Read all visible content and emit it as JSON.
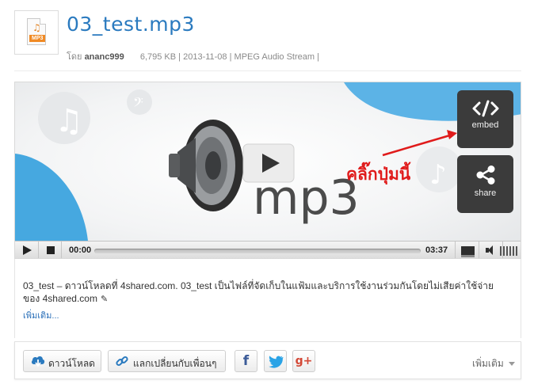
{
  "file": {
    "icon_tag": "MP3",
    "title": "03_test.mp3",
    "meta": {
      "by_label": "โดย",
      "owner": "ananc999",
      "size": "6,795 KB",
      "date": "2013-11-08",
      "type": "MPEG Audio Stream"
    }
  },
  "player": {
    "art_text": "mp3",
    "embed_label": "embed",
    "share_label": "share",
    "annotation": "คลิ๊กปุ่มนี้",
    "current_time": "00:00",
    "duration": "03:37",
    "progress": 0
  },
  "description": {
    "text": "03_test – ดาวน์โหลดที่ 4shared.com. 03_test เป็นไฟล์ที่จัดเก็บในแฟ้มและบริการใช้งานร่วมกันโดยไม่เสียค่าใช้จ่ายของ 4shared.com",
    "more": "เพิ่มเติม..."
  },
  "share_bar": {
    "download": "ดาวน์โหลด",
    "exchange": "แลกเปลี่ยนกับเพื่อนๆ",
    "facebook_glyph": "f",
    "google_glyph": "g+",
    "more": "เพิ่มเติม"
  },
  "colors": {
    "title": "#2a7abf",
    "annotation": "#e01b1b",
    "accent_blue": "#46a8e0",
    "button_dark": "#3b3b3b"
  }
}
